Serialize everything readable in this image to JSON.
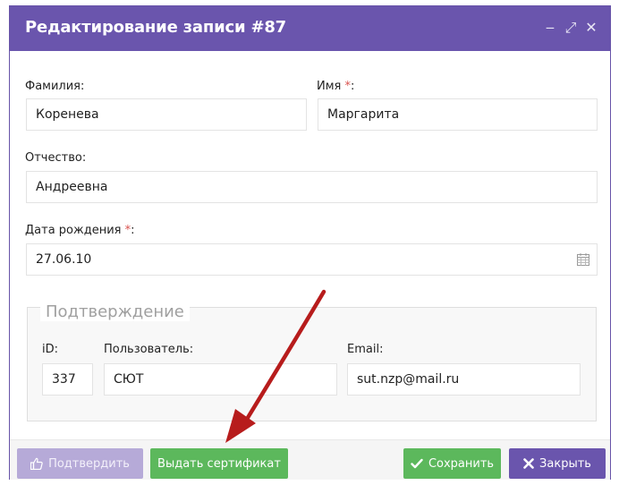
{
  "dialog": {
    "title": "Редактирование записи #87",
    "controls": {
      "minimize": "‒",
      "maximize": "⤢",
      "close": "✕"
    }
  },
  "form": {
    "last_name": {
      "label": "Фамилия:",
      "value": "Коренева"
    },
    "first_name": {
      "label": "Имя",
      "required_mark": "*",
      "colon": ":",
      "value": "Маргарита"
    },
    "patronymic": {
      "label": "Отчество:",
      "value": "Андреевна"
    },
    "birth_date": {
      "label": "Дата рождения",
      "required_mark": "*",
      "colon": ":",
      "value": "27.06.10"
    }
  },
  "confirmation": {
    "legend": "Подтверждение",
    "id": {
      "label": "iD:",
      "value": "337"
    },
    "user": {
      "label": "Пользователь:",
      "value": "СЮТ"
    },
    "email": {
      "label": "Email:",
      "value": "sut.nzp@mail.ru"
    }
  },
  "footer": {
    "confirm_label": "Подтвердить",
    "certificate_label": "Выдать сертификат",
    "save_label": "Сохранить",
    "close_label": "Закрыть"
  },
  "colors": {
    "accent": "#6a55ad",
    "success": "#5cb85c",
    "disabled": "#b6aad8",
    "required": "#d9534f",
    "annotation_arrow": "#b71c1c"
  },
  "icons": {
    "calendar": "calendar-icon",
    "thumbs_up": "thumbs-up-icon",
    "check": "check-icon",
    "close": "close-icon"
  }
}
